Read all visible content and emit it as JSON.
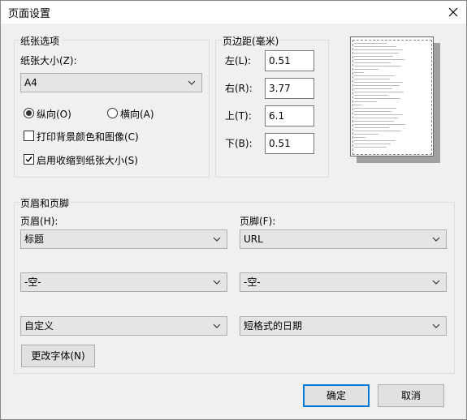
{
  "window": {
    "title": "页面设置"
  },
  "paper": {
    "group_label": "纸张选项",
    "size_label": "纸张大小(Z):",
    "size_value": "A4",
    "portrait_label": "纵向(O)",
    "landscape_label": "横向(A)",
    "orientation_selected": "portrait",
    "print_bg_label": "打印背景颜色和图像(C)",
    "print_bg_checked": false,
    "shrink_label": "启用收缩到纸张大小(S)",
    "shrink_checked": true
  },
  "margins": {
    "group_label": "页边距(毫米)",
    "left_label": "左(L):",
    "left_value": "0.51",
    "right_label": "右(R):",
    "right_value": "3.77",
    "top_label": "上(T):",
    "top_value": "6.1",
    "bottom_label": "下(B):",
    "bottom_value": "0.51"
  },
  "header_footer": {
    "group_label": "页眉和页脚",
    "header_label": "页眉(H):",
    "footer_label": "页脚(F):",
    "header_values": [
      "标题",
      "-空-",
      "自定义"
    ],
    "footer_values": [
      "URL",
      "-空-",
      "短格式的日期"
    ],
    "change_font_label": "更改字体(N)"
  },
  "buttons": {
    "ok_label": "确定",
    "cancel_label": "取消"
  },
  "icons": {
    "close": "close-icon",
    "dropdown": "chevron-down-icon"
  }
}
